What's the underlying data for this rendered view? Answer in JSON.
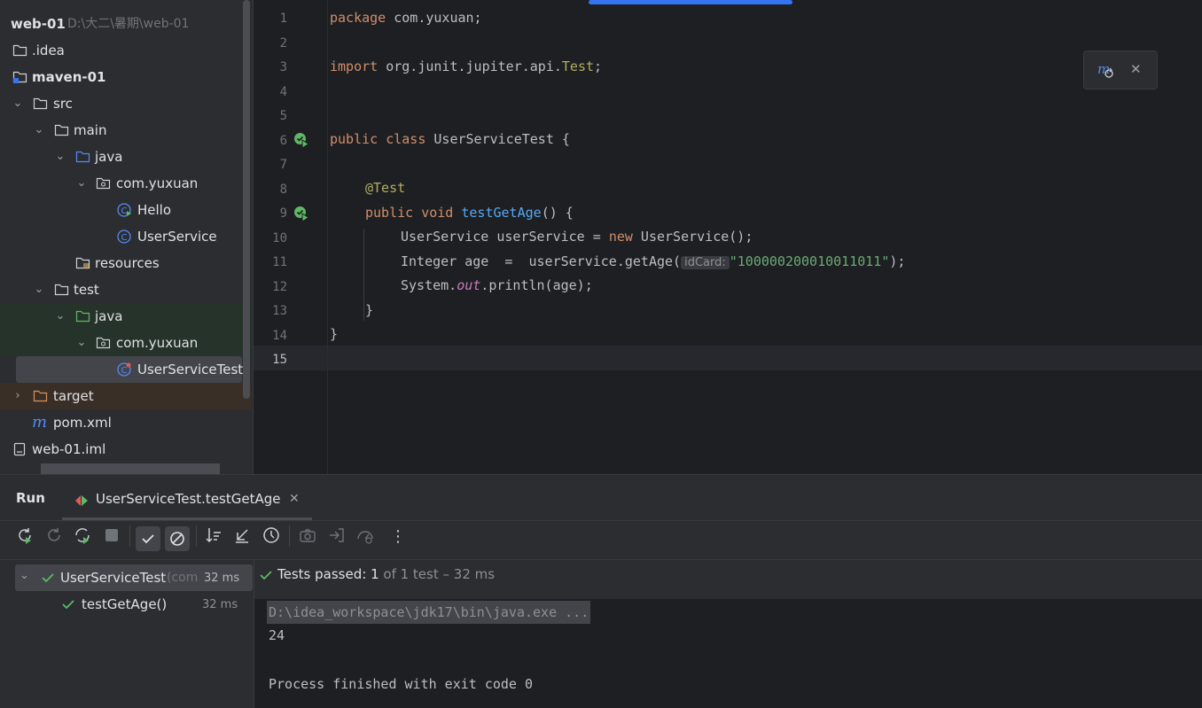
{
  "project": {
    "root_name": "web-01",
    "root_path": "D:\\大二\\暑期\\web-01",
    "items": [
      {
        "label": ".idea",
        "icon": "folder-icon"
      },
      {
        "label": "maven-01",
        "icon": "module-folder-icon"
      },
      {
        "label": "src",
        "icon": "folder-icon"
      },
      {
        "label": "main",
        "icon": "folder-icon"
      },
      {
        "label": "java",
        "icon": "source-folder-icon"
      },
      {
        "label": "com.yuxuan",
        "icon": "package-icon"
      },
      {
        "label": "Hello",
        "icon": "class-run-icon"
      },
      {
        "label": "UserService",
        "icon": "class-icon"
      },
      {
        "label": "resources",
        "icon": "resources-folder-icon"
      },
      {
        "label": "test",
        "icon": "folder-icon"
      },
      {
        "label": "java",
        "icon": "test-folder-icon"
      },
      {
        "label": "com.yuxuan",
        "icon": "package-icon"
      },
      {
        "label": "UserServiceTest",
        "icon": "test-class-icon"
      },
      {
        "label": "target",
        "icon": "excluded-folder-icon"
      },
      {
        "label": "pom.xml",
        "icon": "maven-icon"
      },
      {
        "label": "web-01.iml",
        "icon": "file-icon"
      }
    ]
  },
  "editor": {
    "line_numbers": [
      "1",
      "2",
      "3",
      "4",
      "5",
      "6",
      "7",
      "8",
      "9",
      "10",
      "11",
      "12",
      "13",
      "14",
      "15"
    ],
    "code": {
      "l1_kw": "package",
      "l1_rest": " com.yuxuan;",
      "l3_kw": "import",
      "l3_rest": " org.junit.jupiter.api.",
      "l3_test": "Test",
      "l3_semi": ";",
      "l6_kw": "public class",
      "l6_rest": " UserServiceTest {",
      "l8_ann": "@Test",
      "l9_kw": "public void",
      "l9_fn": "testGetAge",
      "l9_rest": "() {",
      "l10_a": "UserService userService = ",
      "l10_kw": "new",
      "l10_b": " UserService();",
      "l11_a": "Integer age  =  userService.getAge(",
      "l11_hint": "idCard:",
      "l11_str": "\"100000200010011011\"",
      "l11_b": ");",
      "l12_a": "System.",
      "l12_it": "out",
      "l12_b": ".println(age);",
      "l13": "}",
      "l14": "}"
    }
  },
  "run": {
    "panel_title": "Run",
    "tab_label": "UserServiceTest.testGetAge",
    "tree": {
      "suite_name": "UserServiceTest",
      "suite_suffix": "(com",
      "suite_time": "32 ms",
      "test_name": "testGetAge()",
      "test_time": "32 ms"
    },
    "status": {
      "prefix": "Tests passed:",
      "count": "1",
      "suffix": "of 1 test – 32 ms"
    },
    "console": {
      "command": "D:\\idea_workspace\\jdk17\\bin\\java.exe ...",
      "output": "24",
      "finish": "Process finished with exit code 0"
    }
  },
  "colors": {
    "accent": "#3574f0",
    "pass_green": "#5fb865",
    "bg_panel": "#2b2d30",
    "bg_editor": "#1e1f22"
  }
}
